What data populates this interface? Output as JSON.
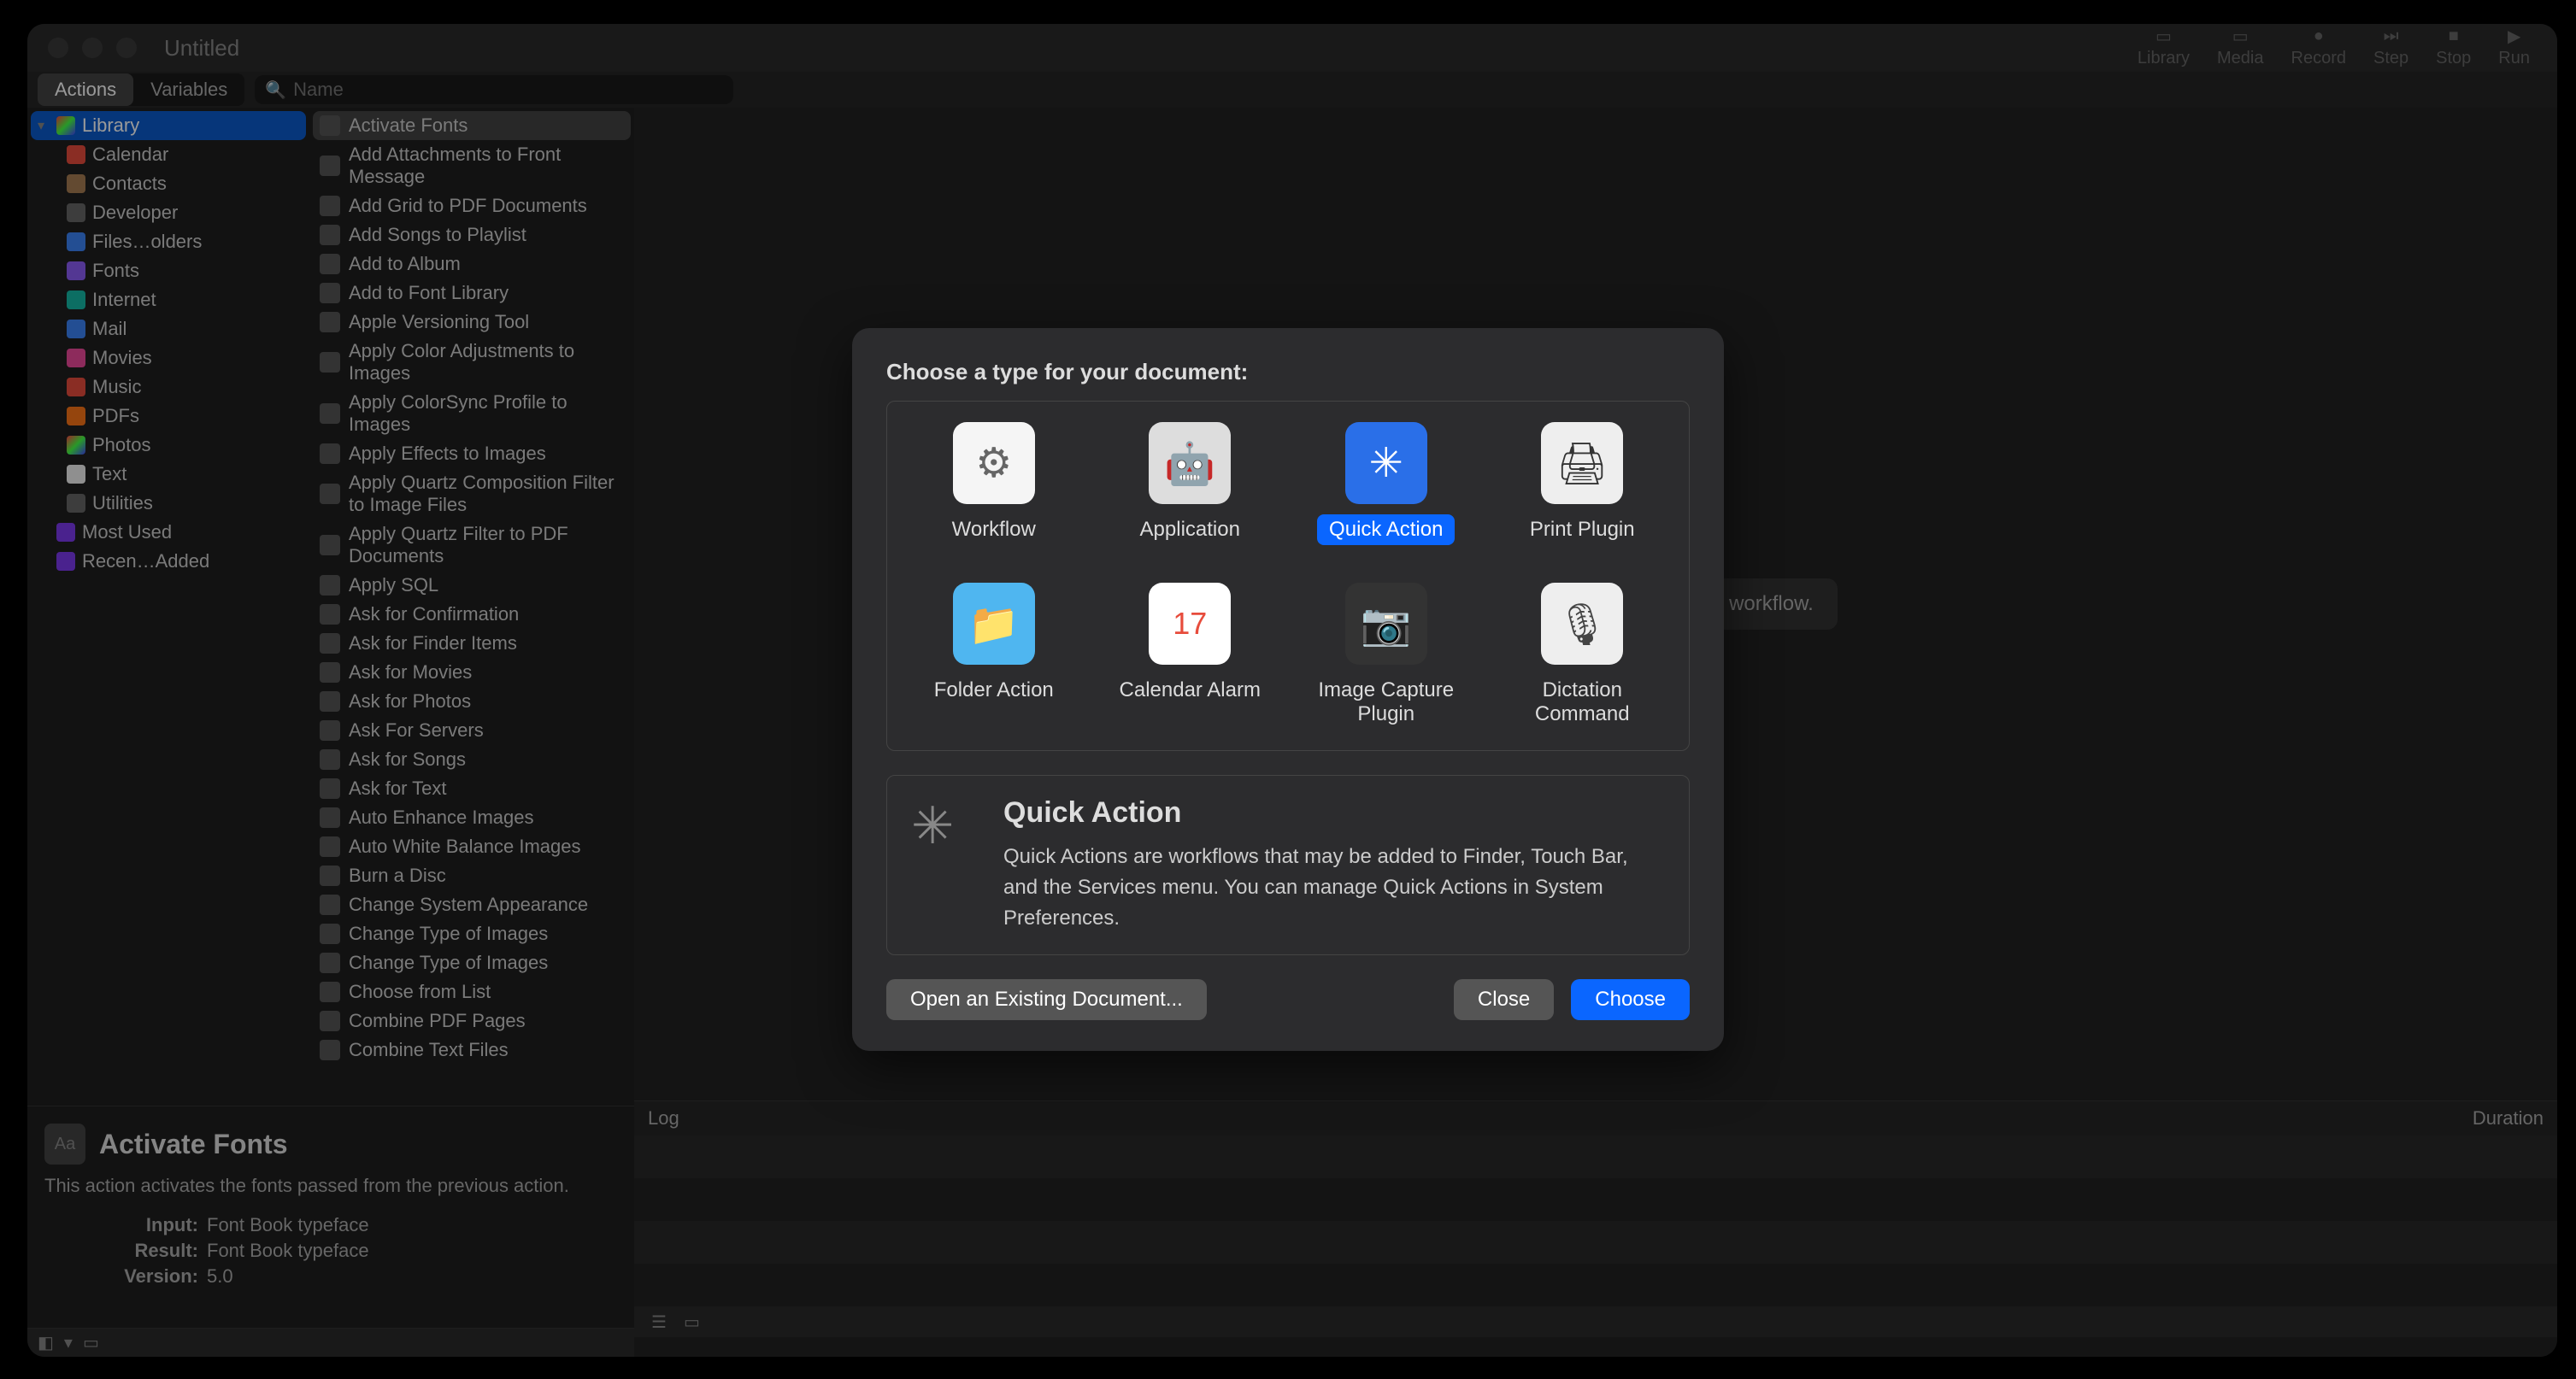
{
  "window": {
    "title": "Untitled"
  },
  "toolbar": {
    "right": [
      "Library",
      "Media",
      "Record",
      "Step",
      "Stop",
      "Run"
    ]
  },
  "subheader": {
    "tabs": [
      "Actions",
      "Variables"
    ],
    "search_placeholder": "Name"
  },
  "library": {
    "root": "Library",
    "items": [
      "Calendar",
      "Contacts",
      "Developer",
      "Files…olders",
      "Fonts",
      "Internet",
      "Mail",
      "Movies",
      "Music",
      "PDFs",
      "Photos",
      "Text",
      "Utilities"
    ],
    "smart": [
      "Most Used",
      "Recen…Added"
    ]
  },
  "actions": [
    "Activate Fonts",
    "Add Attachments to Front Message",
    "Add Grid to PDF Documents",
    "Add Songs to Playlist",
    "Add to Album",
    "Add to Font Library",
    "Apple Versioning Tool",
    "Apply Color Adjustments to Images",
    "Apply ColorSync Profile to Images",
    "Apply Effects to Images",
    "Apply Quartz Composition Filter to Image Files",
    "Apply Quartz Filter to PDF Documents",
    "Apply SQL",
    "Ask for Confirmation",
    "Ask for Finder Items",
    "Ask for Movies",
    "Ask for Photos",
    "Ask For Servers",
    "Ask for Songs",
    "Ask for Text",
    "Auto Enhance Images",
    "Auto White Balance Images",
    "Burn a Disc",
    "Change System Appearance",
    "Change Type of Images",
    "Change Type of Images",
    "Choose from List",
    "Combine PDF Pages",
    "Combine Text Files"
  ],
  "description": {
    "title": "Activate Fonts",
    "text": "This action activates the fonts passed from the previous action.",
    "input_label": "Input:",
    "input_value": "Font Book typeface",
    "result_label": "Result:",
    "result_value": "Font Book typeface",
    "version_label": "Version:",
    "version_value": "5.0"
  },
  "canvas": {
    "hint": "Drag actions or files here to build your workflow."
  },
  "log": {
    "col_log": "Log",
    "col_duration": "Duration"
  },
  "modal": {
    "heading": "Choose a type for your document:",
    "types": [
      {
        "label": "Workflow",
        "icon_class": "icon-workflow",
        "glyph": "⚙"
      },
      {
        "label": "Application",
        "icon_class": "icon-app",
        "glyph": "🤖"
      },
      {
        "label": "Quick Action",
        "icon_class": "icon-quick",
        "glyph": "✳",
        "selected": true
      },
      {
        "label": "Print Plugin",
        "icon_class": "icon-print",
        "glyph": "🖨"
      },
      {
        "label": "Folder Action",
        "icon_class": "icon-folder",
        "glyph": "📁"
      },
      {
        "label": "Calendar Alarm",
        "icon_class": "icon-calendar",
        "glyph": "17"
      },
      {
        "label": "Image Capture Plugin",
        "icon_class": "icon-image",
        "glyph": "📷"
      },
      {
        "label": "Dictation Command",
        "icon_class": "icon-dictation",
        "glyph": "🎙"
      }
    ],
    "desc_title": "Quick Action",
    "desc_text": "Quick Actions are workflows that may be added to Finder, Touch Bar, and the Services menu. You can manage Quick Actions in System Preferences.",
    "btn_open": "Open an Existing Document...",
    "btn_close": "Close",
    "btn_choose": "Choose"
  },
  "lib_icon_classes": [
    "ic-red",
    "ic-brown",
    "ic-gray",
    "ic-blue",
    "ic-purple",
    "ic-teal",
    "ic-blue",
    "ic-pink",
    "ic-red",
    "ic-orange",
    "ic-rainbow",
    "ic-white",
    "ic-gray"
  ]
}
